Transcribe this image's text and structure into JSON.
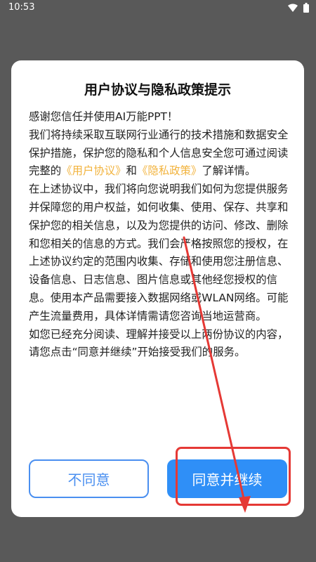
{
  "status_bar": {
    "time": "10:53",
    "icons": [
      "wifi-icon",
      "battery-icon"
    ]
  },
  "dialog": {
    "title": "用户协议与隐私政策提示",
    "intro": "感谢您信任并使用AI万能PPT！",
    "para1_before": "我们将持续采取互联网行业通行的技术措施和数据安全保护措施，保护您的隐私和个人信息安全您可通过阅读完整的",
    "user_agreement_link": "《用户协议》",
    "and": "和",
    "privacy_policy_link": "《隐私政策》",
    "para1_after": "了解详情。",
    "para2": "在上述协议中，我们将向您说明我们如何为您提供服务并保障您的用户权益，如何收集、使用、保存、共享和保护您的相关信息，以及为您提供的访问、修改、删除和您相关的信息的方式。我们会严格按照您的授权，在上述协议约定的范围内收集、存储和使用您注册信息、设备信息、日志信息、图片信息或其他经您授权的信息。使用本产品需要接入数据网络或WLAN网络。可能产生流量费用，具体详情需请您咨询当地运营商。",
    "para3": "如您已经充分阅读、理解并接受以上两份协议的内容，请您点击“同意并继续”开始接受我们的服务。",
    "disagree_label": "不同意",
    "agree_label": "同意并继续"
  },
  "colors": {
    "primary": "#2f8ff7",
    "link": "#f2b33d",
    "annotation": "#e53935",
    "overlay": "#595959"
  }
}
